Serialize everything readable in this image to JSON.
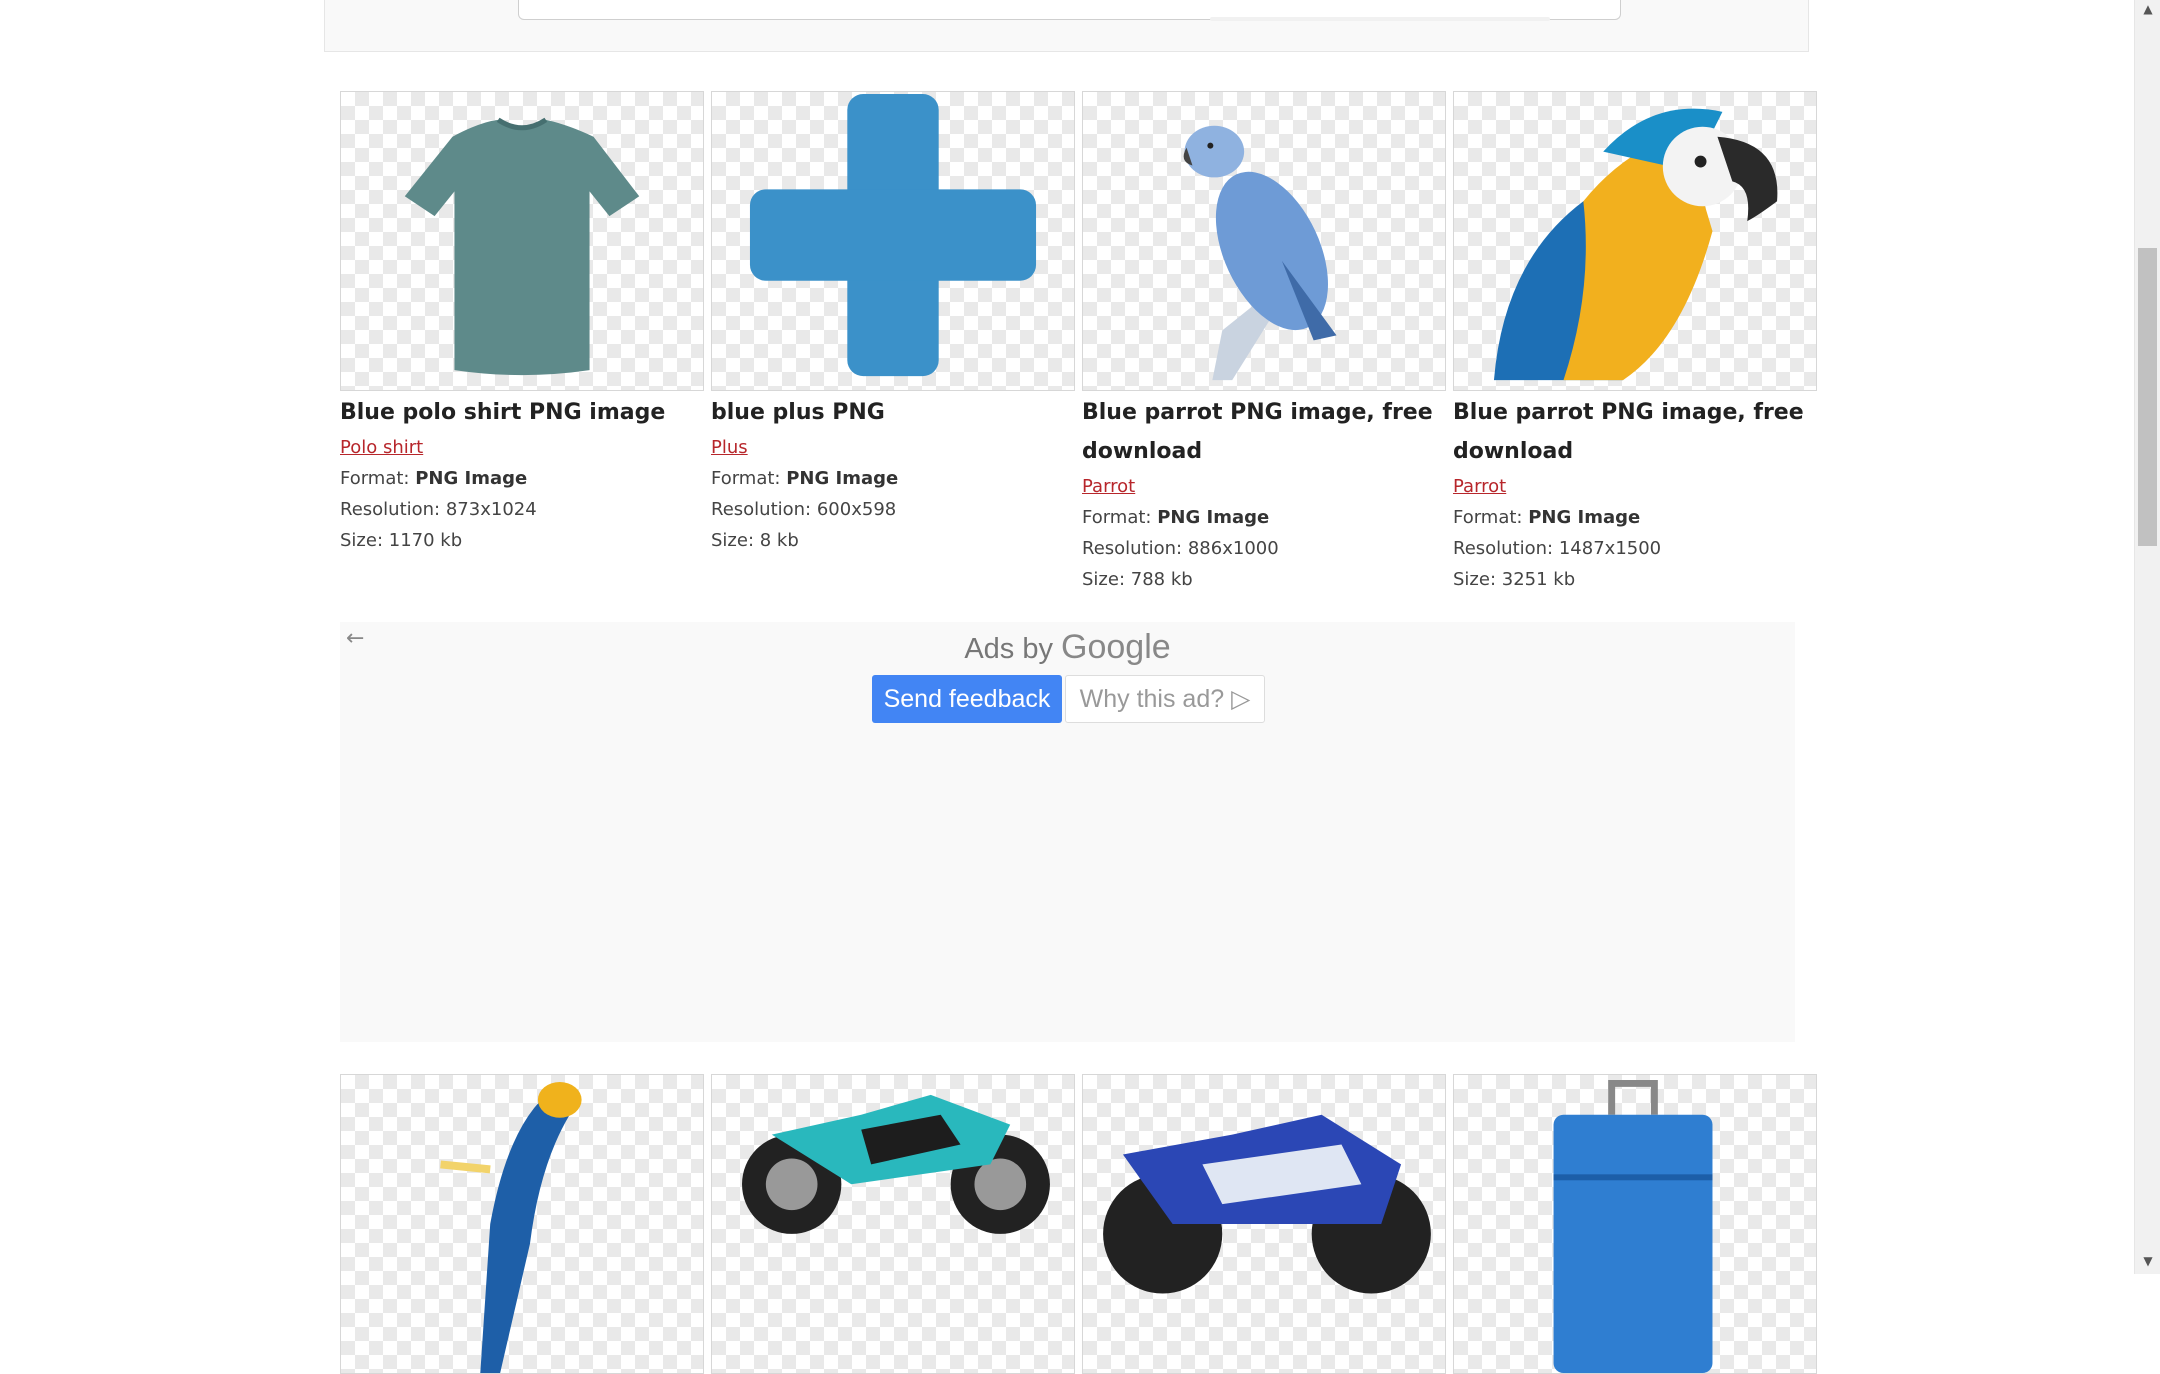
{
  "cards_row1": [
    {
      "title": "Blue polo shirt PNG image",
      "category": "Polo shirt",
      "format_label": "Format:",
      "format": "PNG Image",
      "resolution_label": "Resolution:",
      "resolution": "873x1024",
      "size_label": "Size:",
      "size": "1170 kb"
    },
    {
      "title": "blue plus PNG",
      "category": "Plus",
      "format_label": "Format:",
      "format": "PNG Image",
      "resolution_label": "Resolution:",
      "resolution": "600x598",
      "size_label": "Size:",
      "size": "8 kb"
    },
    {
      "title": "Blue parrot PNG image, free download",
      "category": "Parrot",
      "format_label": "Format:",
      "format": "PNG Image",
      "resolution_label": "Resolution:",
      "resolution": "886x1000",
      "size_label": "Size:",
      "size": "788 kb"
    },
    {
      "title": "Blue parrot PNG image, free download",
      "category": "Parrot",
      "format_label": "Format:",
      "format": "PNG Image",
      "resolution_label": "Resolution:",
      "resolution": "1487x1500",
      "size_label": "Size:",
      "size": "3251 kb"
    }
  ],
  "ad": {
    "ads_by": "Ads by",
    "google": "Google",
    "send_feedback": "Send feedback",
    "why_this_ad": "Why this ad?"
  },
  "row2_icons": [
    "parrot-image",
    "motorcycle-image",
    "suzuki-motorcycle-image",
    "suitcase-image"
  ],
  "colors": {
    "link": "#b7262b",
    "ad_button": "#4285f4",
    "scroll_thumb": "#c1c1c1"
  }
}
